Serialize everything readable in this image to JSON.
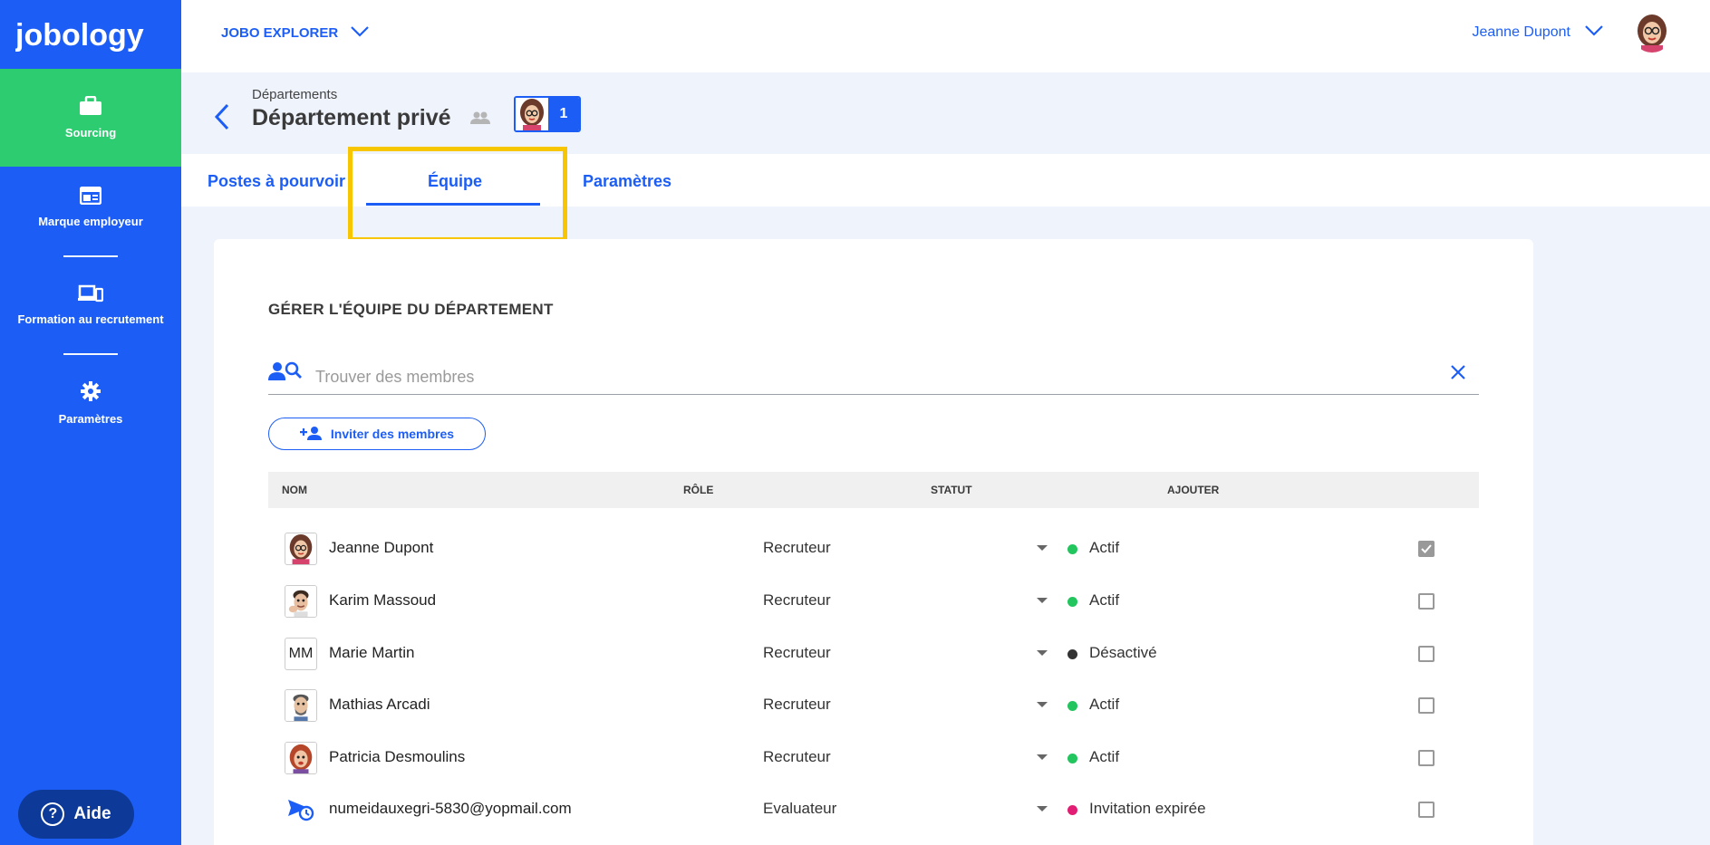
{
  "app": {
    "logo_text": "jobology",
    "explorer_label": "JOBO EXPLORER",
    "user_name": "Jeanne Dupont"
  },
  "sidebar": {
    "items": [
      {
        "label": "Sourcing",
        "icon": "briefcase-icon",
        "active": true
      },
      {
        "label": "Marque employeur",
        "icon": "browser-window-icon",
        "active": false
      },
      {
        "label": "Formation au recrutement",
        "icon": "devices-icon",
        "active": false
      },
      {
        "label": "Paramètres",
        "icon": "gear-icon",
        "active": false
      }
    ],
    "help_label": "Aide"
  },
  "header": {
    "breadcrumb": "Départements",
    "title": "Département privé",
    "member_count": "1"
  },
  "tabs": [
    {
      "label": "Postes à pourvoir",
      "active": false
    },
    {
      "label": "Équipe",
      "active": true
    },
    {
      "label": "Paramètres",
      "active": false
    }
  ],
  "team": {
    "section_title": "GÉRER L'ÉQUIPE DU DÉPARTEMENT",
    "search_placeholder": "Trouver des membres",
    "invite_label": "Inviter des membres",
    "columns": {
      "name": "NOM",
      "role": "RÔLE",
      "status": "STATUT",
      "add": "AJOUTER"
    },
    "members": [
      {
        "name": "Jeanne Dupont",
        "role": "Recruteur",
        "status": "Actif",
        "status_color": "#22c55e",
        "avatar": "caricature-woman-glasses",
        "checked": true
      },
      {
        "name": "Karim Massoud",
        "role": "Recruteur",
        "status": "Actif",
        "status_color": "#22c55e",
        "avatar": "caricature-man-hand",
        "checked": false
      },
      {
        "name": "Marie Martin",
        "role": "Recruteur",
        "status": "Désactivé",
        "status_color": "#333333",
        "avatar_initials": "MM",
        "checked": false
      },
      {
        "name": "Mathias Arcadi",
        "role": "Recruteur",
        "status": "Actif",
        "status_color": "#22c55e",
        "avatar": "caricature-man-beard",
        "checked": false
      },
      {
        "name": "Patricia Desmoulins",
        "role": "Recruteur",
        "status": "Actif",
        "status_color": "#22c55e",
        "avatar": "caricature-woman-redhair",
        "checked": false
      },
      {
        "name": "numeidauxegri-5830@yopmail.com",
        "role": "Evaluateur",
        "status": "Invitation expirée",
        "status_color": "#e11d74",
        "avatar": "send-clock-icon",
        "checked": false
      }
    ]
  },
  "colors": {
    "brand_blue": "#1c5ef5",
    "active_green": "#2ecc71",
    "highlight_yellow": "#f7c600"
  }
}
